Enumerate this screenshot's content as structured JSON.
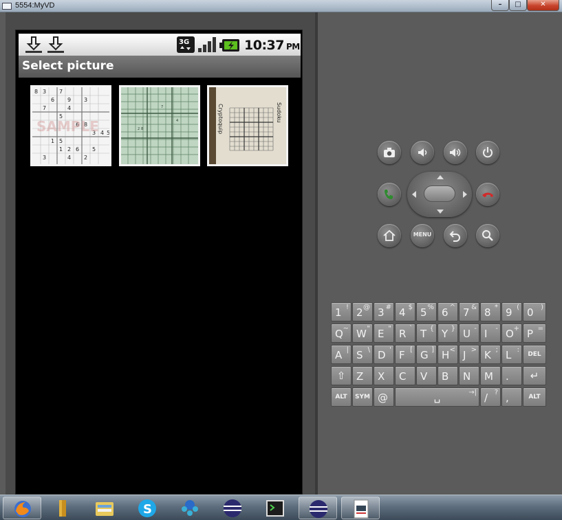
{
  "window": {
    "title": "5554:MyVD",
    "controls": {
      "minimize": "–",
      "maximize": "□",
      "close": "✕"
    }
  },
  "android": {
    "status_bar": {
      "time": "10:37",
      "ampm": "PM",
      "network": "3G",
      "notifications": [
        "download-done-icon",
        "download-done-icon"
      ],
      "icons": [
        "3g-data-icon",
        "signal-strength-icon",
        "battery-charging-icon"
      ]
    },
    "title_bar": {
      "title": "Select picture"
    },
    "pictures": [
      {
        "name": "sample-sudoku",
        "overlay_text": "SAMPLE",
        "digits": "8 3 7 6 9 3 7 4 5 6 8 1 3 4 5 1 5 1 2 6 5 3 4 2"
      },
      {
        "name": "green-grid-photo"
      },
      {
        "name": "sudoku-page-photo",
        "side_texts": [
          "Sudoku",
          "Cryptoquip"
        ]
      }
    ]
  },
  "controls": {
    "buttons": [
      "camera-icon",
      "volume-down-icon",
      "volume-up-icon",
      "power-icon",
      "call-icon",
      "end-call-icon",
      "home-icon",
      "menu-icon",
      "back-icon",
      "search-icon"
    ],
    "menu_label": "MENU"
  },
  "keyboard": {
    "row1": [
      {
        "m": "1",
        "a": "!"
      },
      {
        "m": "2",
        "a": "@"
      },
      {
        "m": "3",
        "a": "#"
      },
      {
        "m": "4",
        "a": "$"
      },
      {
        "m": "5",
        "a": "%"
      },
      {
        "m": "6",
        "a": "^"
      },
      {
        "m": "7",
        "a": "&"
      },
      {
        "m": "8",
        "a": "*"
      },
      {
        "m": "9",
        "a": "("
      },
      {
        "m": "0",
        "a": ")"
      }
    ],
    "row2": [
      {
        "m": "Q",
        "a": "~"
      },
      {
        "m": "W",
        "a": "\""
      },
      {
        "m": "E",
        "a": "\""
      },
      {
        "m": "R",
        "a": "`"
      },
      {
        "m": "T",
        "a": "{"
      },
      {
        "m": "Y",
        "a": "}"
      },
      {
        "m": "U",
        "a": "-"
      },
      {
        "m": "I",
        "a": "-"
      },
      {
        "m": "O",
        "a": "+"
      },
      {
        "m": "P",
        "a": "="
      }
    ],
    "row3": [
      {
        "m": "A",
        "a": "|"
      },
      {
        "m": "S",
        "a": "\\"
      },
      {
        "m": "D",
        "a": "'"
      },
      {
        "m": "F",
        "a": "["
      },
      {
        "m": "G",
        "a": "]"
      },
      {
        "m": "H",
        "a": "<"
      },
      {
        "m": "J",
        "a": ">"
      },
      {
        "m": "K",
        "a": ";"
      },
      {
        "m": "L",
        "a": ":"
      },
      {
        "m": "DEL",
        "a": ""
      }
    ],
    "row4": [
      {
        "m": "⇧",
        "a": ""
      },
      {
        "m": "Z",
        "a": ""
      },
      {
        "m": "X",
        "a": ""
      },
      {
        "m": "C",
        "a": ""
      },
      {
        "m": "V",
        "a": ""
      },
      {
        "m": "B",
        "a": ""
      },
      {
        "m": "N",
        "a": ""
      },
      {
        "m": "M",
        "a": ""
      },
      {
        "m": ".",
        "a": ""
      },
      {
        "m": "↵",
        "a": ""
      }
    ],
    "row5": [
      {
        "m": "ALT",
        "a": ""
      },
      {
        "m": "SYM",
        "a": ""
      },
      {
        "m": "@",
        "a": ""
      },
      {
        "m": "␣",
        "a": "→|"
      },
      {
        "m": "/",
        "a": "?"
      },
      {
        "m": ",",
        "a": ""
      },
      {
        "m": "ALT",
        "a": ""
      }
    ]
  },
  "taskbar": {
    "items": [
      "firefox-icon",
      "folder-icon",
      "file-explorer-icon",
      "skype-icon",
      "network-people-icon",
      "eclipse-icon",
      "terminal-icon",
      "eclipse-icon",
      "java-file-icon"
    ]
  },
  "colors": {
    "call_green": "#2e8b2e",
    "end_call_red": "#d22a2a",
    "battery_green": "#5cbf1e"
  }
}
